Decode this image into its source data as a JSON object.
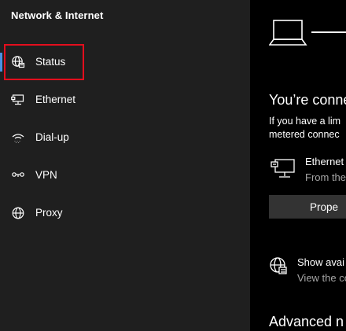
{
  "sidebar": {
    "title": "Network & Internet",
    "items": [
      {
        "label": "Status",
        "icon": "globe-status-icon",
        "active": true
      },
      {
        "label": "Ethernet",
        "icon": "ethernet-icon",
        "active": false
      },
      {
        "label": "Dial-up",
        "icon": "dial-up-icon",
        "active": false
      },
      {
        "label": "VPN",
        "icon": "vpn-icon",
        "active": false
      },
      {
        "label": "Proxy",
        "icon": "globe-icon",
        "active": false
      }
    ]
  },
  "main": {
    "status_heading": "You’re conne",
    "status_desc_line1": "If you have a lim",
    "status_desc_line2": "metered connec",
    "ethernet": {
      "name": "Ethernet",
      "subtext": "From the"
    },
    "properties_button": "Prope",
    "show_available": {
      "label": "Show avai",
      "subtext": "View the co"
    },
    "advanced_heading": "Advanced n"
  },
  "colors": {
    "sidebar_bg": "#1f1f1f",
    "main_bg": "#000000",
    "accent": "#4a90e2",
    "highlight": "#e30e1d",
    "button_bg": "#333333",
    "secondary_text": "#a6a6a6"
  }
}
